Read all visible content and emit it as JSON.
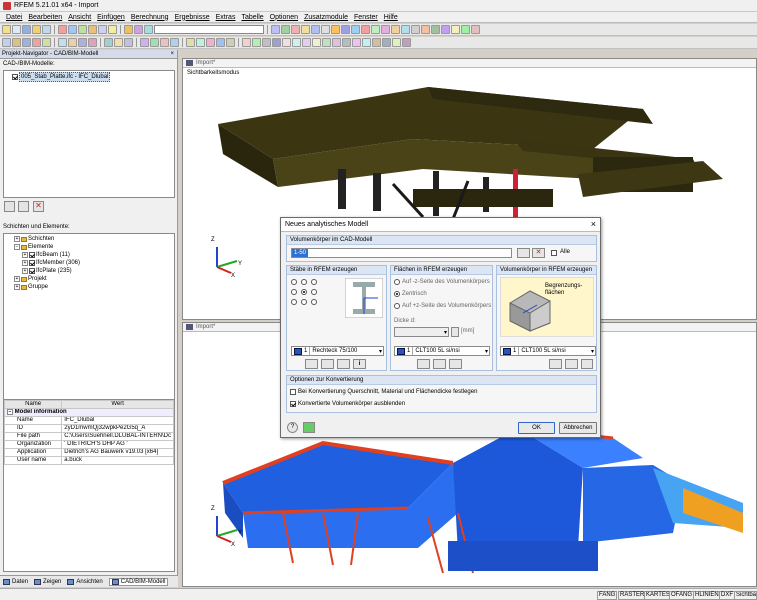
{
  "window": {
    "title": "RFEM 5.21.01 x64 - Import"
  },
  "menu": [
    "Datei",
    "Bearbeiten",
    "Ansicht",
    "Einfügen",
    "Berechnung",
    "Ergebnisse",
    "Extras",
    "Tabelle",
    "Optionen",
    "Zusatzmodule",
    "Fenster",
    "Hilfe"
  ],
  "navigator": {
    "title": "Projekt-Navigator - CAD/BIM-Modell",
    "close": "× ",
    "models_label": "CAD-/BIM-Modelle:",
    "model_item": "005_Stab_Platte.ifc - IFC_Dlubal",
    "layers_label": "Schichten und Elemente:",
    "tree": {
      "schichten": "Schichten",
      "elemente": "Elemente",
      "beam": "IfcBeam (11)",
      "member": "IfcMember (306)",
      "plate": "IfcPlate (235)",
      "projekt": "Projekt",
      "gruppe": "Gruppe"
    },
    "table": {
      "col_name": "Name",
      "col_value": "Wert",
      "section": "Model information",
      "rows": [
        {
          "name": "Name",
          "value": "IFC_Dlubal"
        },
        {
          "name": "ID",
          "value": "2yD1mwmQj32wpkPe2G5q_A"
        },
        {
          "name": "File path",
          "value": "C:\\Users\\Suehnell.DLUBAL-INTERN\\Dc"
        },
        {
          "name": "Organization",
          "value": "' DIETRICH'S DHP AG '"
        },
        {
          "name": "Application",
          "value": "Dietrich's AG Bauwerk v19.03 [x64]"
        },
        {
          "name": "User name",
          "value": "a.buck"
        }
      ]
    },
    "tabs": [
      "Daten",
      "Zeigen",
      "Ansichten",
      "CAD/BIM-Modell"
    ]
  },
  "view_top": {
    "title": "Import*",
    "mode": "Sichtbarkeitsmodus"
  },
  "view_bottom": {
    "title": "Import*"
  },
  "axes": {
    "x": "X",
    "y": "Y",
    "z": "Z"
  },
  "dialog": {
    "title": "Neues analytisches Modell",
    "close": "×",
    "body_label": "Volumenkörper im CAD-Modell",
    "body_value": "1-50",
    "all_label": "Alle",
    "stab": {
      "title": "Stäbe in RFEM erzeugen",
      "section_no": "1",
      "section": "Rechteck 75/100"
    },
    "flaechen": {
      "title": "Flächen in RFEM erzeugen",
      "opt1": "Auf -z-Seite des Volumenkörpers",
      "opt2": "Zentrisch",
      "opt3": "Auf +z-Seite des Volumenkörpers",
      "thickness_label": "Dicke d:",
      "unit": "[mm]",
      "material_no": "1",
      "material": "CLT100 5L si/nsi"
    },
    "volumen": {
      "title": "Volumenkörper in RFEM erzeugen",
      "callout": "Begrenzungs-flächen",
      "material_no": "1",
      "material": "CLT100 5L si/nsi"
    },
    "konvertierung": {
      "title": "Optionen zur Konvertierung",
      "opt1": "Bei Konvertierung Querschnitt, Material und Flächendicke festlegen",
      "opt2": "Konvertierte Volumenkörper ausblenden"
    },
    "ok": "OK",
    "cancel": "Abbrechen"
  },
  "status": [
    "FANG",
    "RASTER",
    "KARTES",
    "OFANG",
    "HLINIEN",
    "DXF",
    "Sichtbar"
  ],
  "colors": {
    "accent": "#2255cc",
    "steel": "#e0401f",
    "roof_dark": "#3b3512"
  }
}
